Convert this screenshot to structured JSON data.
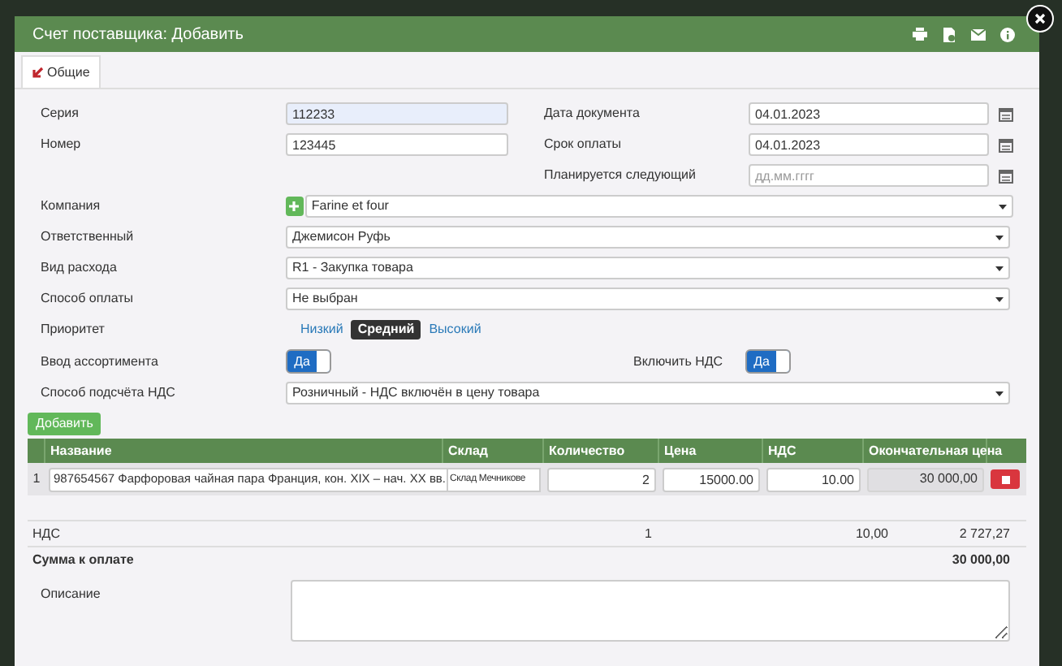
{
  "window": {
    "title": "Счет поставщика: Добавить"
  },
  "tabs": [
    {
      "label": "Общие",
      "selected": true
    }
  ],
  "fields_left": [
    {
      "label": "Серия",
      "value": "112233",
      "focused": true
    },
    {
      "label": "Номер",
      "value": "123445",
      "focused": false
    }
  ],
  "fields_right": [
    {
      "label": "Дата документа",
      "value": "04.01.2023"
    },
    {
      "label": "Срок оплаты",
      "value": "04.01.2023"
    },
    {
      "label": "Планируется следующий",
      "placeholder": "дд.мм.гггг"
    }
  ],
  "selects": [
    {
      "label": "Компания",
      "value": "Farine et four",
      "has_add": true
    },
    {
      "label": "Ответственный",
      "value": "Джемисон Руфь",
      "has_add": false
    },
    {
      "label": "Вид расхода",
      "value": "R1 - Закупка товара",
      "has_add": false
    },
    {
      "label": "Способ оплаты",
      "value": "Не выбран",
      "has_add": false
    }
  ],
  "priority": {
    "label": "Приоритет",
    "options": [
      {
        "label": "Низкий",
        "selected": false
      },
      {
        "label": "Средний",
        "selected": true
      },
      {
        "label": "Высокий",
        "selected": false
      }
    ]
  },
  "toggles": [
    {
      "label": "Ввод ассортимента",
      "text": "Да",
      "on": true
    },
    {
      "label": "Включить НДС",
      "text": "Да",
      "on": true
    }
  ],
  "vat_method": {
    "label": "Способ подсчёта НДС",
    "value": "Розничный - НДС включён в цену товара"
  },
  "add_button": "Добавить",
  "table": {
    "columns": [
      "Название",
      "Склад",
      "Количество",
      "Цена",
      "НДС",
      "Окончательная цена"
    ],
    "rows": [
      {
        "index": "1",
        "name": "987654567 Фарфоровая чайная пара Франция, кон. XIX – нач. XX вв.",
        "warehouse": "Склад Мечникове",
        "quantity": "2",
        "price": "15000.00",
        "vat": "10.00",
        "final_price": "30 000,00"
      }
    ]
  },
  "summary": [
    {
      "kind": "vat",
      "label": "НДС",
      "count": "1",
      "rate": "10,00",
      "amount": "2 727,27"
    },
    {
      "kind": "total",
      "label": "Сумма к оплате",
      "amount": "30 000,00"
    }
  ],
  "description": {
    "label": "Описание"
  }
}
